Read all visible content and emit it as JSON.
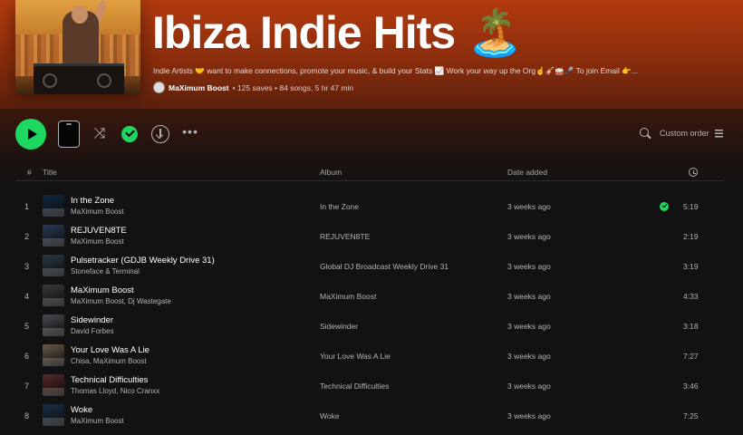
{
  "playlist": {
    "title": "Ibiza Indie Hits 🏝️",
    "description": "Indie Artists 🤝 want to make connections, promote your music, & build your Stats 📈 Work your way up the Org☝️🎸🥁🎤 To join Email 👉...",
    "owner": "MaXimum Boost",
    "stats": "• 125 saves • 84 songs, 5 hr 47 min"
  },
  "controls": {
    "sort_label": "Custom order",
    "icons": [
      "play-icon",
      "mini-player-icon",
      "shuffle-icon",
      "added-check-icon",
      "download-icon",
      "more-icon",
      "search-icon",
      "list-icon"
    ]
  },
  "table": {
    "headers": {
      "num": "#",
      "title": "Title",
      "album": "Album",
      "date": "Date added"
    },
    "rows": [
      {
        "num": "1",
        "title": "In the Zone",
        "artist": "MaXimum Boost",
        "album": "In the Zone",
        "date": "3 weeks ago",
        "duration": "5:19",
        "saved": true,
        "art": "#0f2a3f"
      },
      {
        "num": "2",
        "title": "REJUVEN8TE",
        "artist": "MaXimum Boost",
        "album": "REJUVEN8TE",
        "date": "3 weeks ago",
        "duration": "2:19",
        "saved": false,
        "art": "#2a3b55"
      },
      {
        "num": "3",
        "title": "Pulsetracker (GDJB Weekly Drive 31)",
        "artist": "Stoneface & Terminal",
        "album": "Global DJ Broadcast Weekly Drive 31",
        "date": "3 weeks ago",
        "duration": "3:19",
        "saved": false,
        "art": "#2b3a46"
      },
      {
        "num": "4",
        "title": "MaXimum Boost",
        "artist": "MaXimum Boost, Dj Wastegate",
        "album": "MaXimum Boost",
        "date": "3 weeks ago",
        "duration": "4:33",
        "saved": false,
        "art": "#3b3b3b"
      },
      {
        "num": "5",
        "title": "Sidewinder",
        "artist": "David Forbes",
        "album": "Sidewinder",
        "date": "3 weeks ago",
        "duration": "3:18",
        "saved": false,
        "art": "#4a4a52"
      },
      {
        "num": "6",
        "title": "Your Love Was A Lie",
        "artist": "Chisa, MaXimum Boost",
        "album": "Your Love Was A Lie",
        "date": "3 weeks ago",
        "duration": "7:27",
        "saved": false,
        "art": "#6a5a4a"
      },
      {
        "num": "7",
        "title": "Technical Difficulties",
        "artist": "Thomas Lloyd, Nico Cranxx",
        "album": "Technical Difficulties",
        "date": "3 weeks ago",
        "duration": "3:46",
        "saved": false,
        "art": "#5a2a2a"
      },
      {
        "num": "8",
        "title": "Woke",
        "artist": "MaXimum Boost",
        "album": "Woke",
        "date": "3 weeks ago",
        "duration": "7:25",
        "saved": false,
        "art": "#1c3046"
      }
    ]
  }
}
